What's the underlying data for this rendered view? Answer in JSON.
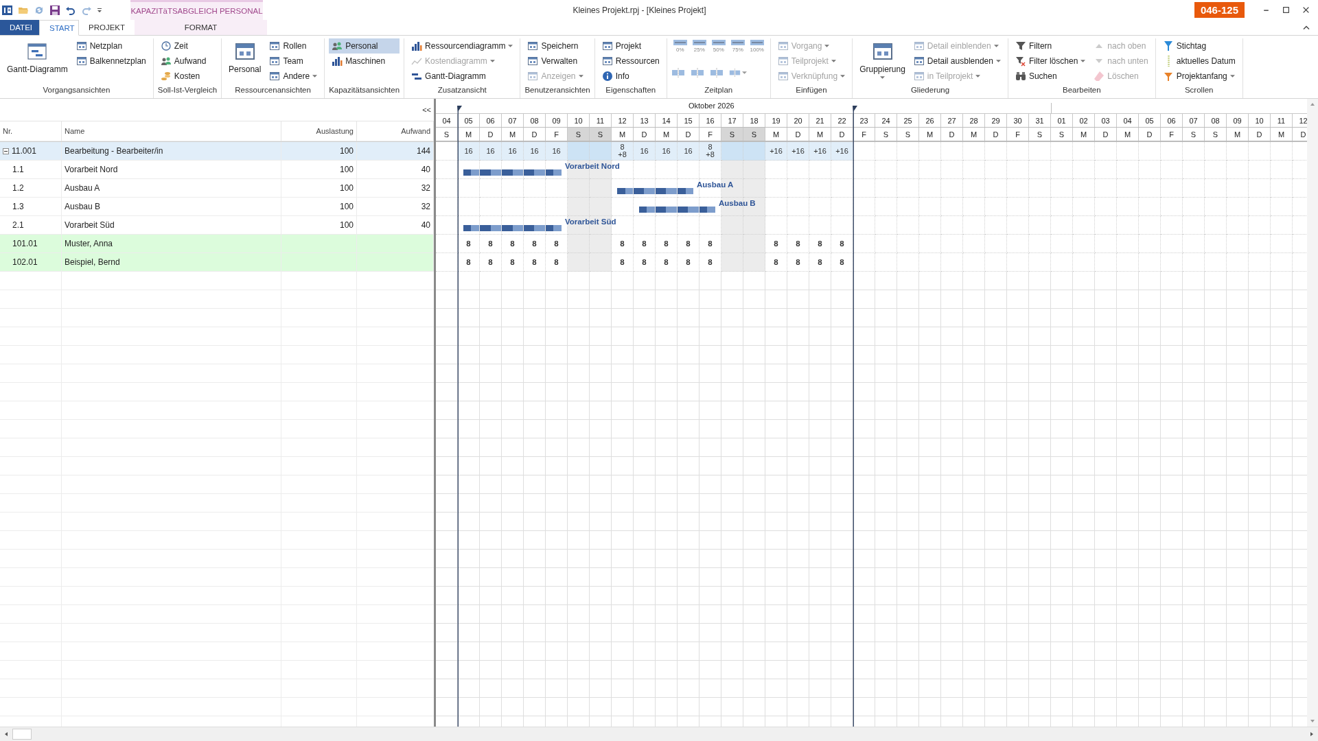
{
  "window": {
    "title": "Kleines Projekt.rpj - [Kleines Projekt]",
    "badge": "046-125",
    "context_group": "KAPAZITäTSABGLEICH PERSONAL"
  },
  "tabs": [
    {
      "label": "DATEI",
      "kind": "file",
      "selected": false
    },
    {
      "label": "START",
      "kind": "normal",
      "selected": true
    },
    {
      "label": "PROJEKT",
      "kind": "normal",
      "selected": false
    },
    {
      "label": "FORMAT",
      "kind": "context",
      "selected": false
    }
  ],
  "ribbon": {
    "groups": [
      {
        "label": "Vorgangsansichten",
        "kind": "grid",
        "items": [
          {
            "label": "Gantt-Diagramm",
            "kind": "large",
            "disabled": false,
            "dropdown": false,
            "selected": false
          },
          {
            "label": "Netzplan",
            "kind": "small",
            "disabled": false,
            "dropdown": false,
            "selected": false
          },
          {
            "label": "Balkennetzplan",
            "kind": "small",
            "disabled": false,
            "dropdown": false,
            "selected": false
          }
        ]
      },
      {
        "label": "Soll-Ist-Vergleich",
        "kind": "grid",
        "items": [
          {
            "label": "Zeit",
            "kind": "small",
            "disabled": false,
            "dropdown": false,
            "selected": false
          },
          {
            "label": "Aufwand",
            "kind": "small",
            "disabled": false,
            "dropdown": false,
            "selected": false
          },
          {
            "label": "Kosten",
            "kind": "small",
            "disabled": false,
            "dropdown": false,
            "selected": false
          }
        ]
      },
      {
        "label": "Ressourcenansichten",
        "kind": "grid",
        "items": [
          {
            "label": "Personal",
            "kind": "large",
            "disabled": false,
            "dropdown": false,
            "selected": false
          },
          {
            "label": "Rollen",
            "kind": "small",
            "disabled": false,
            "dropdown": false,
            "selected": false
          },
          {
            "label": "Team",
            "kind": "small",
            "disabled": false,
            "dropdown": false,
            "selected": false
          },
          {
            "label": "Andere",
            "kind": "small",
            "disabled": false,
            "dropdown": true,
            "selected": false
          }
        ]
      },
      {
        "label": "Kapazitätsansichten",
        "kind": "grid",
        "items": [
          {
            "label": "Personal",
            "kind": "small",
            "disabled": false,
            "dropdown": false,
            "selected": true
          },
          {
            "label": "Maschinen",
            "kind": "small",
            "disabled": false,
            "dropdown": false,
            "selected": false
          }
        ]
      },
      {
        "label": "Zusatzansicht",
        "kind": "grid",
        "items": [
          {
            "label": "Ressourcendiagramm",
            "kind": "small",
            "disabled": false,
            "dropdown": true,
            "selected": false
          },
          {
            "label": "Kostendiagramm",
            "kind": "small",
            "disabled": true,
            "dropdown": true,
            "selected": false
          },
          {
            "label": "Gantt-Diagramm",
            "kind": "small",
            "disabled": false,
            "dropdown": false,
            "selected": false
          }
        ]
      },
      {
        "label": "Benutzeransichten",
        "kind": "grid",
        "items": [
          {
            "label": "Speichern",
            "kind": "small",
            "disabled": false,
            "dropdown": false,
            "selected": false
          },
          {
            "label": "Verwalten",
            "kind": "small",
            "disabled": false,
            "dropdown": false,
            "selected": false
          },
          {
            "label": "Anzeigen",
            "kind": "small",
            "disabled": true,
            "dropdown": true,
            "selected": false
          }
        ]
      },
      {
        "label": "Eigenschaften",
        "kind": "grid",
        "items": [
          {
            "label": "Projekt",
            "kind": "small",
            "disabled": false,
            "dropdown": false,
            "selected": false
          },
          {
            "label": "Ressourcen",
            "kind": "small",
            "disabled": false,
            "dropdown": false,
            "selected": false
          },
          {
            "label": "Info",
            "kind": "small",
            "disabled": false,
            "dropdown": false,
            "selected": false
          }
        ]
      },
      {
        "label": "Zeitplan",
        "kind": "timeline",
        "items": [
          {
            "kind": "percent",
            "label": "0%",
            "dropdown": false
          },
          {
            "kind": "percent",
            "label": "25%",
            "dropdown": false
          },
          {
            "kind": "percent",
            "label": "50%",
            "dropdown": false
          },
          {
            "kind": "percent",
            "label": "75%",
            "dropdown": false
          },
          {
            "kind": "percent",
            "label": "100%",
            "dropdown": false
          },
          {
            "kind": "icon",
            "dropdown": false
          },
          {
            "kind": "icon",
            "dropdown": false
          },
          {
            "kind": "icon",
            "dropdown": false
          },
          {
            "kind": "icon",
            "dropdown": true
          }
        ]
      },
      {
        "label": "Einfügen",
        "kind": "grid",
        "items": [
          {
            "label": "Vorgang",
            "kind": "small",
            "disabled": true,
            "dropdown": true,
            "selected": false
          },
          {
            "label": "Teilprojekt",
            "kind": "small",
            "disabled": true,
            "dropdown": true,
            "selected": false
          },
          {
            "label": "Verknüpfung",
            "kind": "small",
            "disabled": true,
            "dropdown": true,
            "selected": false
          }
        ]
      },
      {
        "label": "Gliederung",
        "kind": "grid",
        "items": [
          {
            "label": "Gruppierung",
            "kind": "large",
            "disabled": false,
            "dropdown": true,
            "selected": false
          },
          {
            "label": "Detail einblenden",
            "kind": "small",
            "disabled": true,
            "dropdown": true,
            "selected": false
          },
          {
            "label": "Detail ausblenden",
            "kind": "small",
            "disabled": false,
            "dropdown": true,
            "selected": false
          },
          {
            "label": "in Teilprojekt",
            "kind": "small",
            "disabled": true,
            "dropdown": true,
            "selected": false
          }
        ]
      },
      {
        "label": "Bearbeiten",
        "kind": "grid",
        "items": [
          {
            "label": "Filtern",
            "kind": "small",
            "disabled": false,
            "dropdown": false,
            "selected": false
          },
          {
            "label": "Filter löschen",
            "kind": "small",
            "disabled": false,
            "dropdown": true,
            "selected": false
          },
          {
            "label": "Suchen",
            "kind": "small",
            "disabled": false,
            "dropdown": false,
            "selected": false
          },
          {
            "label": "nach oben",
            "kind": "small",
            "disabled": true,
            "dropdown": false,
            "selected": false
          },
          {
            "label": "nach unten",
            "kind": "small",
            "disabled": true,
            "dropdown": false,
            "selected": false
          },
          {
            "label": "Löschen",
            "kind": "small",
            "disabled": true,
            "dropdown": false,
            "selected": false
          }
        ]
      },
      {
        "label": "Scrollen",
        "kind": "grid",
        "items": [
          {
            "label": "Stichtag",
            "kind": "small",
            "disabled": false,
            "dropdown": false,
            "selected": false
          },
          {
            "label": "aktuelles Datum",
            "kind": "small",
            "disabled": false,
            "dropdown": false,
            "selected": false
          },
          {
            "label": "Projektanfang",
            "kind": "small",
            "disabled": false,
            "dropdown": true,
            "selected": false
          }
        ]
      }
    ]
  },
  "table": {
    "collapse_button": "<<",
    "columns": [
      {
        "label": "Nr."
      },
      {
        "label": "Name"
      },
      {
        "label": "Auslastung"
      },
      {
        "label": "Aufwand"
      }
    ],
    "rows": [
      {
        "kind": "summary",
        "nr": "11.001",
        "name": "Bearbeitung - Bearbeiter/in",
        "auslastung": "100",
        "aufwand": "144",
        "expanded": true
      },
      {
        "kind": "task",
        "nr": "1.1",
        "name": "Vorarbeit Nord",
        "auslastung": "100",
        "aufwand": "40",
        "bar_label": "Vorarbeit Nord"
      },
      {
        "kind": "task",
        "nr": "1.2",
        "name": "Ausbau A",
        "auslastung": "100",
        "aufwand": "32",
        "bar_label": "Ausbau A"
      },
      {
        "kind": "task",
        "nr": "1.3",
        "name": "Ausbau B",
        "auslastung": "100",
        "aufwand": "32",
        "bar_label": "Ausbau B"
      },
      {
        "kind": "task",
        "nr": "2.1",
        "name": "Vorarbeit Süd",
        "auslastung": "100",
        "aufwand": "40",
        "bar_label": "Vorarbeit Süd"
      },
      {
        "kind": "resource",
        "nr": "101.01",
        "name": "Muster, Anna"
      },
      {
        "kind": "resource",
        "nr": "102.01",
        "name": "Beispiel, Bernd"
      }
    ]
  },
  "gantt": {
    "month": "Oktober 2026",
    "days": [
      {
        "date": "04",
        "weekday": "S",
        "shaded": false,
        "active": false
      },
      {
        "date": "05",
        "weekday": "M",
        "shaded": false,
        "active": true,
        "summary": [
          "16"
        ],
        "resources": [
          "8",
          "8"
        ],
        "bars": [
          true,
          false,
          false,
          true
        ]
      },
      {
        "date": "06",
        "weekday": "D",
        "shaded": false,
        "active": true,
        "summary": [
          "16"
        ],
        "resources": [
          "8",
          "8"
        ],
        "bars": [
          true,
          false,
          false,
          true
        ]
      },
      {
        "date": "07",
        "weekday": "M",
        "shaded": false,
        "active": true,
        "summary": [
          "16"
        ],
        "resources": [
          "8",
          "8"
        ],
        "bars": [
          true,
          false,
          false,
          true
        ]
      },
      {
        "date": "08",
        "weekday": "D",
        "shaded": false,
        "active": true,
        "summary": [
          "16"
        ],
        "resources": [
          "8",
          "8"
        ],
        "bars": [
          true,
          false,
          false,
          true
        ]
      },
      {
        "date": "09",
        "weekday": "F",
        "shaded": false,
        "active": true,
        "summary": [
          "16"
        ],
        "resources": [
          "8",
          "8"
        ],
        "bars": [
          true,
          false,
          false,
          true
        ]
      },
      {
        "date": "10",
        "weekday": "S",
        "shaded": true,
        "active": true
      },
      {
        "date": "11",
        "weekday": "S",
        "shaded": true,
        "active": true
      },
      {
        "date": "12",
        "weekday": "M",
        "shaded": false,
        "active": true,
        "summary": [
          "8",
          "+8"
        ],
        "resources": [
          "8",
          "8"
        ],
        "bars": [
          false,
          true,
          false,
          false
        ]
      },
      {
        "date": "13",
        "weekday": "D",
        "shaded": false,
        "active": true,
        "summary": [
          "16"
        ],
        "resources": [
          "8",
          "8"
        ],
        "bars": [
          false,
          true,
          true,
          false
        ]
      },
      {
        "date": "14",
        "weekday": "M",
        "shaded": false,
        "active": true,
        "summary": [
          "16"
        ],
        "resources": [
          "8",
          "8"
        ],
        "bars": [
          false,
          true,
          true,
          false
        ]
      },
      {
        "date": "15",
        "weekday": "D",
        "shaded": false,
        "active": true,
        "summary": [
          "16"
        ],
        "resources": [
          "8",
          "8"
        ],
        "bars": [
          false,
          true,
          true,
          false
        ]
      },
      {
        "date": "16",
        "weekday": "F",
        "shaded": false,
        "active": true,
        "summary": [
          "8",
          "+8"
        ],
        "resources": [
          "8",
          "8"
        ],
        "bars": [
          false,
          false,
          true,
          false
        ]
      },
      {
        "date": "17",
        "weekday": "S",
        "shaded": true,
        "active": true
      },
      {
        "date": "18",
        "weekday": "S",
        "shaded": true,
        "active": true
      },
      {
        "date": "19",
        "weekday": "M",
        "shaded": false,
        "active": true,
        "summary": [
          "+16"
        ],
        "resources": [
          "8",
          "8"
        ]
      },
      {
        "date": "20",
        "weekday": "D",
        "shaded": false,
        "active": true,
        "summary": [
          "+16"
        ],
        "resources": [
          "8",
          "8"
        ]
      },
      {
        "date": "21",
        "weekday": "M",
        "shaded": false,
        "active": true,
        "summary": [
          "+16"
        ],
        "resources": [
          "8",
          "8"
        ]
      },
      {
        "date": "22",
        "weekday": "D",
        "shaded": false,
        "active": true,
        "summary": [
          "+16"
        ],
        "resources": [
          "8",
          "8"
        ]
      },
      {
        "date": "23",
        "weekday": "F",
        "shaded": false,
        "active": false
      },
      {
        "date": "24",
        "weekday": "S",
        "shaded": false,
        "active": false
      },
      {
        "date": "25",
        "weekday": "S",
        "shaded": false,
        "active": false
      },
      {
        "date": "26",
        "weekday": "M",
        "shaded": false,
        "active": false
      },
      {
        "date": "27",
        "weekday": "D",
        "shaded": false,
        "active": false
      },
      {
        "date": "28",
        "weekday": "M",
        "shaded": false,
        "active": false
      },
      {
        "date": "29",
        "weekday": "D",
        "shaded": false,
        "active": false
      },
      {
        "date": "30",
        "weekday": "F",
        "shaded": false,
        "active": false
      },
      {
        "date": "31",
        "weekday": "S",
        "shaded": false,
        "active": false
      },
      {
        "date": "01",
        "weekday": "S",
        "shaded": false,
        "active": false,
        "month_start": true
      },
      {
        "date": "02",
        "weekday": "M",
        "shaded": false,
        "active": false
      },
      {
        "date": "03",
        "weekday": "D",
        "shaded": false,
        "active": false
      },
      {
        "date": "04",
        "weekday": "M",
        "shaded": false,
        "active": false
      },
      {
        "date": "05",
        "weekday": "D",
        "shaded": false,
        "active": false
      },
      {
        "date": "06",
        "weekday": "F",
        "shaded": false,
        "active": false
      },
      {
        "date": "07",
        "weekday": "S",
        "shaded": false,
        "active": false
      },
      {
        "date": "08",
        "weekday": "S",
        "shaded": false,
        "active": false
      },
      {
        "date": "09",
        "weekday": "M",
        "shaded": false,
        "active": false
      },
      {
        "date": "10",
        "weekday": "D",
        "shaded": false,
        "active": false
      },
      {
        "date": "11",
        "weekday": "M",
        "shaded": false,
        "active": false
      },
      {
        "date": "12",
        "weekday": "D",
        "shaded": false,
        "active": false
      }
    ]
  }
}
